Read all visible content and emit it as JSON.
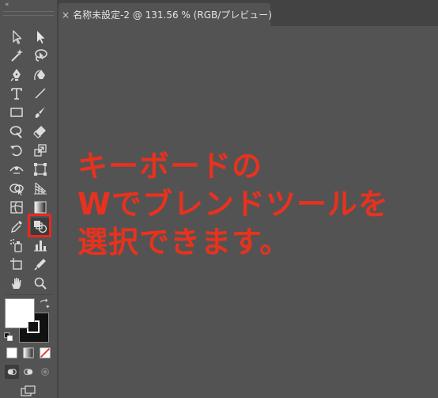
{
  "document_tab": {
    "close_symbol": "×",
    "title": "名称未設定-2 @ 131.56 % (RGB/プレビュー)"
  },
  "toolbar": {
    "collapse_symbol": "«",
    "tools": [
      {
        "id": "selection-tool-icon"
      },
      {
        "id": "direct-selection-tool-icon"
      },
      {
        "id": "magic-wand-tool-icon"
      },
      {
        "id": "lasso-tool-icon"
      },
      {
        "id": "pen-tool-icon"
      },
      {
        "id": "curvature-tool-icon"
      },
      {
        "id": "type-tool-icon",
        "glyph": "T"
      },
      {
        "id": "line-segment-tool-icon"
      },
      {
        "id": "rectangle-tool-icon"
      },
      {
        "id": "paintbrush-tool-icon"
      },
      {
        "id": "shaper-tool-icon"
      },
      {
        "id": "eraser-tool-icon"
      },
      {
        "id": "rotate-tool-icon"
      },
      {
        "id": "scale-tool-icon"
      },
      {
        "id": "width-tool-icon"
      },
      {
        "id": "free-transform-tool-icon"
      },
      {
        "id": "shape-builder-tool-icon"
      },
      {
        "id": "perspective-grid-tool-icon"
      },
      {
        "id": "mesh-tool-icon"
      },
      {
        "id": "gradient-tool-icon"
      },
      {
        "id": "eyedropper-tool-icon"
      },
      {
        "id": "blend-tool-icon"
      },
      {
        "id": "symbol-sprayer-tool-icon"
      },
      {
        "id": "column-graph-tool-icon"
      },
      {
        "id": "artboard-tool-icon"
      },
      {
        "id": "slice-tool-icon"
      },
      {
        "id": "hand-tool-icon"
      },
      {
        "id": "zoom-tool-icon"
      }
    ],
    "highlighted_tool": "blend-tool-icon"
  },
  "colors": {
    "panel_bg": "#535353",
    "tabbar_bg": "#434343",
    "annotation": "#e8321e",
    "highlight_border": "#e8291f",
    "fill_color": "#ffffff",
    "stroke_color": "#111111"
  },
  "annotation": {
    "line1": "キーボードの",
    "line2": "Wでブレンドツールを",
    "line3": "選択できます。"
  }
}
